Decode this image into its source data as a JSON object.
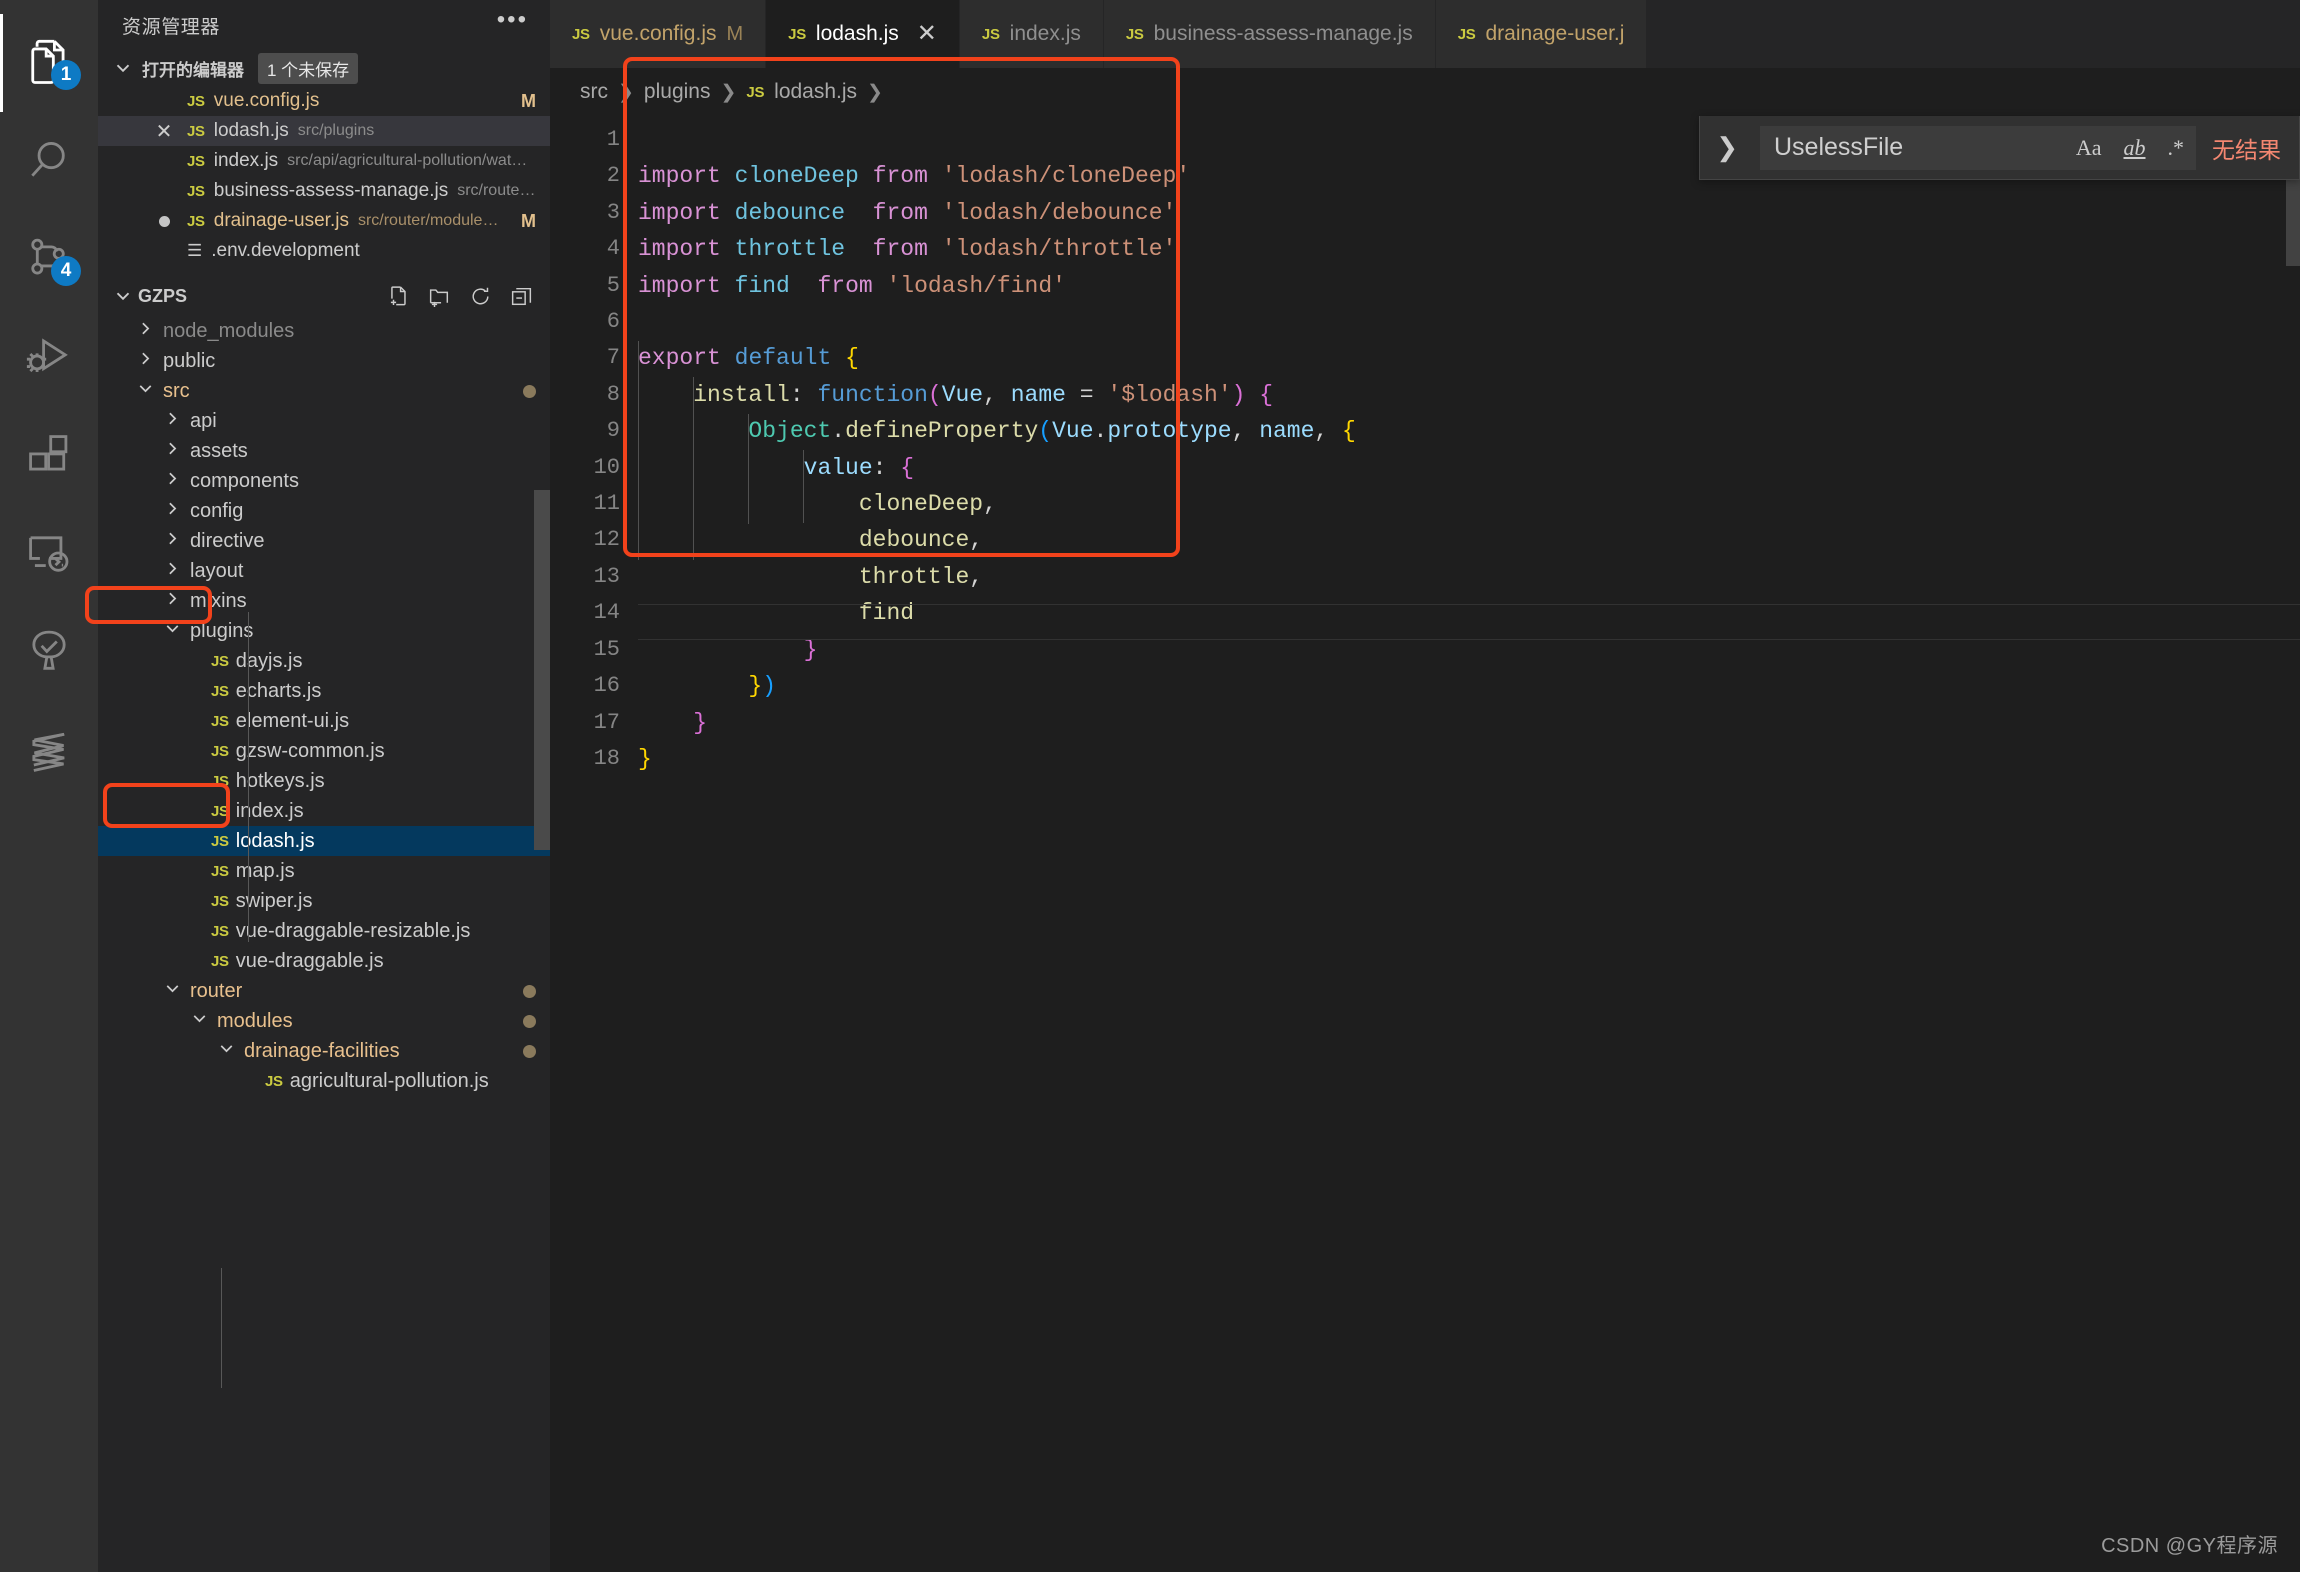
{
  "activity_bar": {
    "items": [
      {
        "name": "explorer",
        "icon": "files-icon",
        "badge": "1",
        "active": true
      },
      {
        "name": "search",
        "icon": "search-icon",
        "badge": null,
        "active": false
      },
      {
        "name": "source-control",
        "icon": "source-control-icon",
        "badge": "4",
        "active": false
      },
      {
        "name": "run-and-debug",
        "icon": "run-debug-icon",
        "badge": null,
        "active": false
      },
      {
        "name": "extensions",
        "icon": "extensions-icon",
        "badge": null,
        "active": false
      },
      {
        "name": "remote-explorer",
        "icon": "remote-explorer-icon",
        "badge": null,
        "active": false
      },
      {
        "name": "testing",
        "icon": "testing-beaker-icon",
        "badge": null,
        "active": false
      },
      {
        "name": "custom-tool",
        "icon": "s-logo-icon",
        "badge": null,
        "active": false
      }
    ]
  },
  "sidebar": {
    "title": "资源管理器",
    "more_actions_icon": "ellipsis-icon",
    "open_editors": {
      "label": "打开的编辑器",
      "unsaved_badge": "1 个未保存",
      "items": [
        {
          "icon": "js-icon",
          "prefix": "",
          "name": "vue.config.js",
          "desc": "",
          "flag": "M",
          "selected": false,
          "modified": true
        },
        {
          "icon": "js-icon",
          "prefix": "close-icon",
          "name": "lodash.js",
          "desc": "src/plugins",
          "flag": "",
          "selected": true,
          "modified": false
        },
        {
          "icon": "js-icon",
          "prefix": "",
          "name": "index.js",
          "desc": "src/api/agricultural-pollution/water-qualit...",
          "flag": "",
          "selected": false,
          "modified": false
        },
        {
          "icon": "js-icon",
          "prefix": "",
          "name": "business-assess-manage.js",
          "desc": "src/router/modules",
          "flag": "",
          "selected": false,
          "modified": false
        },
        {
          "icon": "js-icon",
          "prefix": "dirty-dot",
          "name": "drainage-user.js",
          "desc": "src/router/modules/draina...",
          "flag": "M",
          "selected": false,
          "modified": true
        },
        {
          "icon": "settings-file-icon",
          "prefix": "",
          "name": ".env.development",
          "desc": "",
          "flag": "",
          "selected": false,
          "modified": false
        }
      ]
    },
    "workspace": {
      "name": "GZPS",
      "actions": [
        {
          "name": "new-file-icon"
        },
        {
          "name": "new-folder-icon"
        },
        {
          "name": "refresh-icon"
        },
        {
          "name": "collapse-all-icon"
        }
      ],
      "tree": [
        {
          "label": "node_modules",
          "type": "folder",
          "state": "collapsed",
          "depth": 1,
          "style": "dim"
        },
        {
          "label": "public",
          "type": "folder",
          "state": "collapsed",
          "depth": 1,
          "style": "normal"
        },
        {
          "label": "src",
          "type": "folder",
          "state": "expanded",
          "depth": 1,
          "style": "accent",
          "dot": true
        },
        {
          "label": "api",
          "type": "folder",
          "state": "collapsed",
          "depth": 2,
          "style": "normal"
        },
        {
          "label": "assets",
          "type": "folder",
          "state": "collapsed",
          "depth": 2,
          "style": "normal"
        },
        {
          "label": "components",
          "type": "folder",
          "state": "collapsed",
          "depth": 2,
          "style": "normal"
        },
        {
          "label": "config",
          "type": "folder",
          "state": "collapsed",
          "depth": 2,
          "style": "normal"
        },
        {
          "label": "directive",
          "type": "folder",
          "state": "collapsed",
          "depth": 2,
          "style": "normal"
        },
        {
          "label": "layout",
          "type": "folder",
          "state": "collapsed",
          "depth": 2,
          "style": "normal"
        },
        {
          "label": "mixins",
          "type": "folder",
          "state": "collapsed",
          "depth": 2,
          "style": "normal"
        },
        {
          "label": "plugins",
          "type": "folder",
          "state": "expanded",
          "depth": 2,
          "style": "normal",
          "highlight": true
        },
        {
          "label": "dayjs.js",
          "type": "file",
          "depth": 3,
          "style": "normal"
        },
        {
          "label": "echarts.js",
          "type": "file",
          "depth": 3,
          "style": "normal"
        },
        {
          "label": "element-ui.js",
          "type": "file",
          "depth": 3,
          "style": "normal"
        },
        {
          "label": "gzsw-common.js",
          "type": "file",
          "depth": 3,
          "style": "normal"
        },
        {
          "label": "hotkeys.js",
          "type": "file",
          "depth": 3,
          "style": "normal"
        },
        {
          "label": "index.js",
          "type": "file",
          "depth": 3,
          "style": "normal"
        },
        {
          "label": "lodash.js",
          "type": "file",
          "depth": 3,
          "style": "normal",
          "selected": true,
          "highlight": true
        },
        {
          "label": "map.js",
          "type": "file",
          "depth": 3,
          "style": "normal"
        },
        {
          "label": "swiper.js",
          "type": "file",
          "depth": 3,
          "style": "normal"
        },
        {
          "label": "vue-draggable-resizable.js",
          "type": "file",
          "depth": 3,
          "style": "normal"
        },
        {
          "label": "vue-draggable.js",
          "type": "file",
          "depth": 3,
          "style": "normal"
        },
        {
          "label": "router",
          "type": "folder",
          "state": "expanded",
          "depth": 2,
          "style": "accent",
          "dot": true
        },
        {
          "label": "modules",
          "type": "folder",
          "state": "expanded",
          "depth": 3,
          "style": "accent",
          "dot": true
        },
        {
          "label": "drainage-facilities",
          "type": "folder",
          "state": "expanded",
          "depth": 4,
          "style": "accent",
          "dot": true
        },
        {
          "label": "agricultural-pollution.js",
          "type": "file",
          "depth": 5,
          "style": "normal"
        }
      ]
    }
  },
  "editor": {
    "tabs": [
      {
        "name": "vue.config.js",
        "icon": "js-icon",
        "flag": "M",
        "active": false,
        "closable": false,
        "modified": true
      },
      {
        "name": "lodash.js",
        "icon": "js-icon",
        "flag": "",
        "active": true,
        "closable": true,
        "modified": false
      },
      {
        "name": "index.js",
        "icon": "js-icon",
        "flag": "",
        "active": false,
        "closable": false,
        "modified": false
      },
      {
        "name": "business-assess-manage.js",
        "icon": "js-icon",
        "flag": "",
        "active": false,
        "closable": false,
        "modified": false
      },
      {
        "name": "drainage-user.j",
        "icon": "js-icon",
        "flag": "",
        "active": false,
        "closable": false,
        "modified": true
      }
    ],
    "breadcrumb": [
      "src",
      "plugins",
      "lodash.js"
    ],
    "breadcrumb_file_icon": "js-icon",
    "line_numbers": [
      "1",
      "2",
      "3",
      "4",
      "5",
      "6",
      "7",
      "8",
      "9",
      "10",
      "11",
      "12",
      "13",
      "14",
      "15",
      "16",
      "17",
      "18"
    ],
    "code_lines": [
      "import cloneDeep from 'lodash/cloneDeep'",
      "import debounce  from 'lodash/debounce'",
      "import throttle  from 'lodash/throttle'",
      "import find  from 'lodash/find'",
      "",
      "export default {",
      "    install: function(Vue, name = '$lodash') {",
      "        Object.defineProperty(Vue.prototype, name, {",
      "            value: {",
      "                cloneDeep,",
      "                debounce,",
      "                throttle,",
      "                find",
      "            }",
      "        })",
      "    }",
      "}",
      ""
    ]
  },
  "find_widget": {
    "expand_icon": "chevron-right-icon",
    "query": "UselessFile",
    "match_case_label": "Aa",
    "whole_word_label": "ab",
    "regex_label": ".*",
    "result_text": "无结果"
  },
  "watermark": "CSDN @GY程序源",
  "colors": {
    "accent_blue": "#0e7ac4",
    "selection_blue": "#04395e",
    "annotation_red": "#f2421b",
    "modified_amber": "#e2c08d",
    "no_result_red": "#f48771"
  }
}
